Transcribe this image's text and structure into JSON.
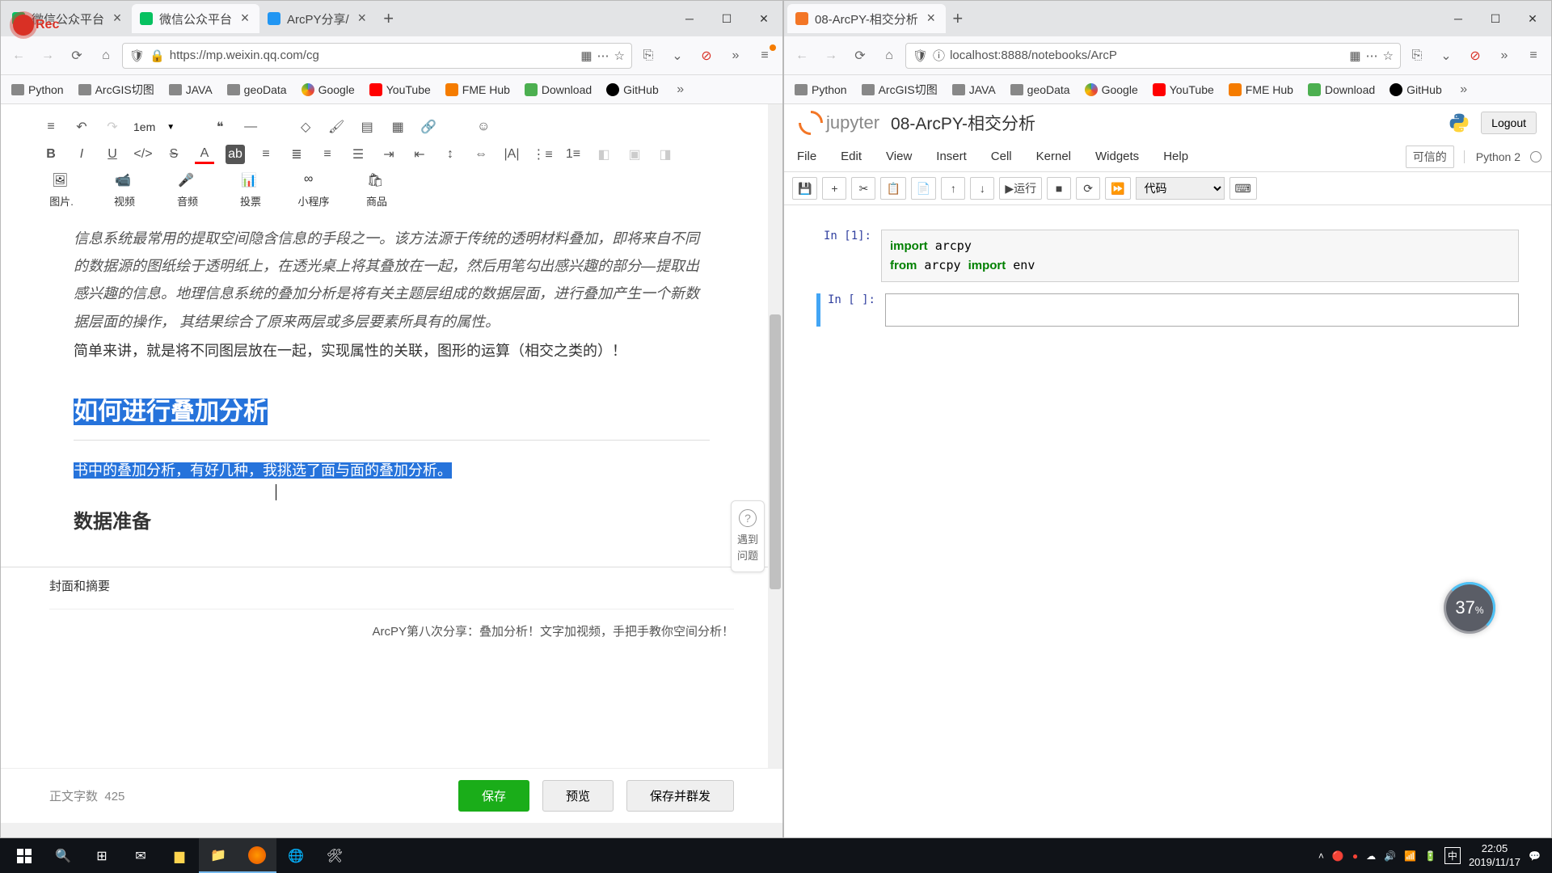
{
  "left_window": {
    "tabs": [
      {
        "title": "微信公众平台",
        "favicon_color": "#07c160"
      },
      {
        "title": "微信公众平台",
        "favicon_color": "#07c160",
        "active": true
      },
      {
        "title": "ArcPY分享/",
        "favicon_color": "#2196f3"
      }
    ],
    "url": "https://mp.weixin.qq.com/cg",
    "bookmarks": [
      "Python",
      "ArcGIS切图",
      "JAVA",
      "geoData",
      "Google",
      "YouTube",
      "FME Hub",
      "Download",
      "GitHub"
    ],
    "editor": {
      "font_size_label": "1em",
      "media_buttons": [
        "图片.",
        "视频",
        "音频",
        "投票",
        "小程序",
        "商品"
      ],
      "para1": "信息系统最常用的提取空间隐含信息的手段之一。该方法源于传统的透明材料叠加，即将来自不同的数据源的图纸绘于透明纸上，在透光桌上将其叠放在一起，然后用笔勾出感兴趣的部分—提取出感兴趣的信息。地理信息系统的叠加分析是将有关主题层组成的数据层面，进行叠加产生一个新数据层面的操作， 其结果综合了原来两层或多层要素所具有的属性。",
      "para2": "简单来讲，就是将不同图层放在一起，实现属性的关联，图形的运算（相交之类的）！",
      "h2_selected": "如何进行叠加分析",
      "p_selected": "书中的叠加分析，有好几种，我挑选了面与面的叠加分析。",
      "h3": "数据准备",
      "cover_label": "封面和摘要",
      "abstract": "ArcPY第八次分享：叠加分析！文字加视频，手把手教你空间分析！",
      "help_float": "遇到问题",
      "word_count_label": "正文字数",
      "word_count": "425",
      "btn_save": "保存",
      "btn_preview": "预览",
      "btn_publish": "保存并群发"
    }
  },
  "right_window": {
    "tabs": [
      {
        "title": "08-ArcPY-相交分析",
        "favicon_color": "#f37626",
        "active": true
      }
    ],
    "url": "localhost:8888/notebooks/ArcP",
    "bookmarks": [
      "Python",
      "ArcGIS切图",
      "JAVA",
      "geoData",
      "Google",
      "YouTube",
      "FME Hub",
      "Download",
      "GitHub"
    ],
    "jupyter": {
      "logo_text": "jupyter",
      "notebook_name": "08-ArcPY-相交分析",
      "logout": "Logout",
      "menus": [
        "File",
        "Edit",
        "View",
        "Insert",
        "Cell",
        "Kernel",
        "Widgets",
        "Help"
      ],
      "trusted": "可信的",
      "kernel": "Python 2",
      "run_label": "运行",
      "cell_type": "代码",
      "cells": [
        {
          "prompt": "In [1]:",
          "lines": [
            [
              "kw:import",
              " arcpy"
            ],
            [
              "kw:from",
              " arcpy ",
              "kw:import",
              " env"
            ]
          ]
        },
        {
          "prompt": "In [ ]:",
          "lines": [
            [
              ""
            ]
          ],
          "active": true
        }
      ]
    }
  },
  "percent_badge": "37",
  "percent_unit": "%",
  "taskbar": {
    "time": "22:05",
    "date": "2019/11/17",
    "ime": "中"
  }
}
